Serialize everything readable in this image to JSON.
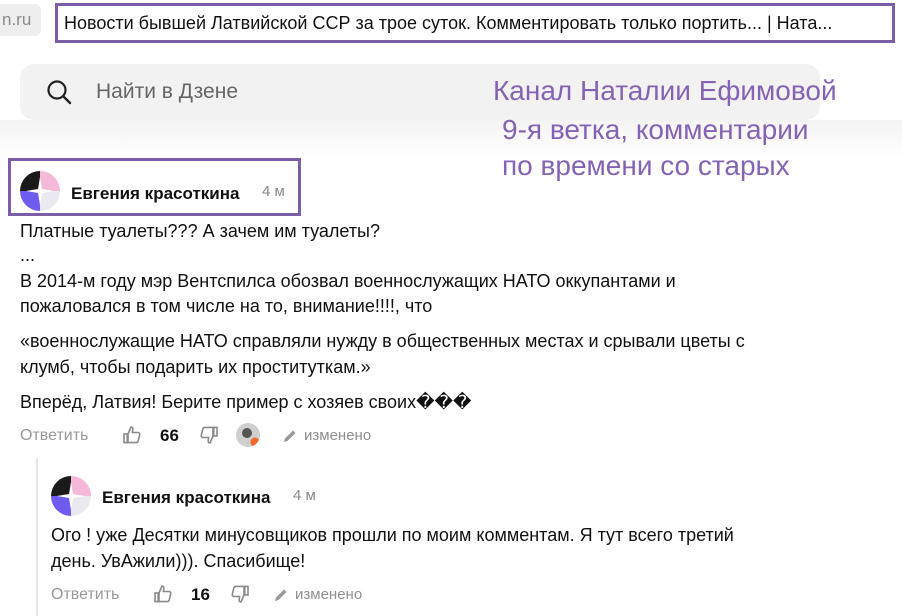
{
  "browser": {
    "url_fragment": "n.ru",
    "tab_title": "Новости бывшей Латвийской ССР за трое суток. Комментировать только портить... | Ната..."
  },
  "search": {
    "placeholder": "Найти в Дзене"
  },
  "overlay_note": {
    "line1": "Канал Наталии Ефимовой",
    "line2": "9-я ветка, комментарии",
    "line3": "по времени со старых"
  },
  "colors": {
    "accent": "#7b5ea7",
    "note_text": "#8463b4",
    "muted": "#999999"
  },
  "comments": [
    {
      "author": "Евгения красоткина",
      "time": "4 м",
      "lines": [
        "Платные туалеты??? А зачем им туалеты?",
        "...",
        "В 2014-м году мэр Вентспилса обозвал военнослужащих НАТО оккупантами и",
        "пожаловался в том числе на то, внимание!!!!, что",
        "«военнослужащие НАТО справляли нужду в общественных местах и срывали цветы с",
        "клумб, чтобы подарить их проституткам.»",
        "Вперёд, Латвия! Берите пример с хозяев своих���"
      ],
      "reply_label": "Ответить",
      "likes": "66",
      "edited_label": "изменено",
      "icons": [
        "like-icon",
        "dislike-icon",
        "reaction-avatar-icon",
        "pencil-icon"
      ]
    },
    {
      "author": "Евгения красоткина",
      "time": "4 м",
      "lines": [
        "Ого ! уже Десятки минусовщиков прошли по моим комментам. Я тут всего третий",
        "день. УвАжили))). Спасибище!"
      ],
      "reply_label": "Ответить",
      "likes": "16",
      "edited_label": "изменено",
      "icons": [
        "like-icon",
        "dislike-icon",
        "pencil-icon"
      ]
    }
  ]
}
